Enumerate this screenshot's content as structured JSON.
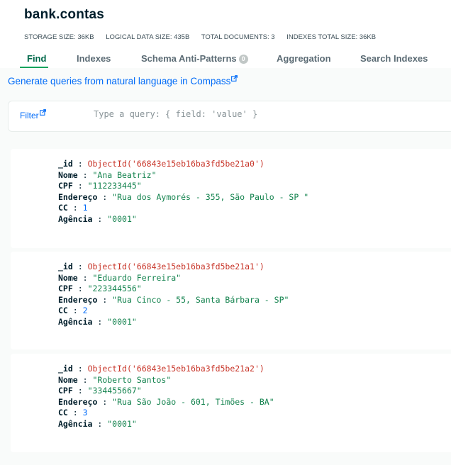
{
  "title": "bank.contas",
  "stats": {
    "storage": "STORAGE SIZE: 36KB",
    "logical": "LOGICAL DATA SIZE: 435B",
    "docs": "TOTAL DOCUMENTS: 3",
    "indexes": "INDEXES TOTAL SIZE: 36KB"
  },
  "tabs": {
    "find": "Find",
    "indexes": "Indexes",
    "schema": "Schema Anti-Patterns",
    "schema_count": "0",
    "aggregation": "Aggregation",
    "search_indexes": "Search Indexes"
  },
  "nl_link": "Generate queries from natural language in Compass",
  "filter": {
    "label": "Filter",
    "placeholder": "Type a query: { field: 'value' }"
  },
  "documents": [
    {
      "id_key": "_id",
      "id_value": "ObjectId('66843e15eb16ba3fd5be21a0')",
      "nome_key": "Nome",
      "nome": "\"Ana Beatriz\"",
      "cpf_key": "CPF",
      "cpf": "\"112233445\"",
      "endereco_key": "Endereço",
      "endereco": "\"Rua dos Aymorés - 355, São Paulo - SP \"",
      "cc_key": "CC",
      "cc": "1",
      "agencia_key": "Agência",
      "agencia": "\"0001\""
    },
    {
      "id_key": "_id",
      "id_value": "ObjectId('66843e15eb16ba3fd5be21a1')",
      "nome_key": "Nome",
      "nome": "\"Eduardo Ferreira\"",
      "cpf_key": "CPF",
      "cpf": "\"223344556\"",
      "endereco_key": "Endereço",
      "endereco": "\"Rua Cinco - 55, Santa Bárbara - SP\"",
      "cc_key": "CC",
      "cc": "2",
      "agencia_key": "Agência",
      "agencia": "\"0001\""
    },
    {
      "id_key": "_id",
      "id_value": "ObjectId('66843e15eb16ba3fd5be21a2')",
      "nome_key": "Nome",
      "nome": "\"Roberto Santos\"",
      "cpf_key": "CPF",
      "cpf": "\"334455667\"",
      "endereco_key": "Endereço",
      "endereco": "\"Rua São João - 601, Timões - BA\"",
      "cc_key": "CC",
      "cc": "3",
      "agencia_key": "Agência",
      "agencia": "\"0001\""
    }
  ],
  "colors": {
    "active_tab": "#00684a",
    "link": "#016bf8",
    "string_value": "#12824d",
    "objectid_value": "#c83529",
    "number_value": "#016bf8"
  }
}
